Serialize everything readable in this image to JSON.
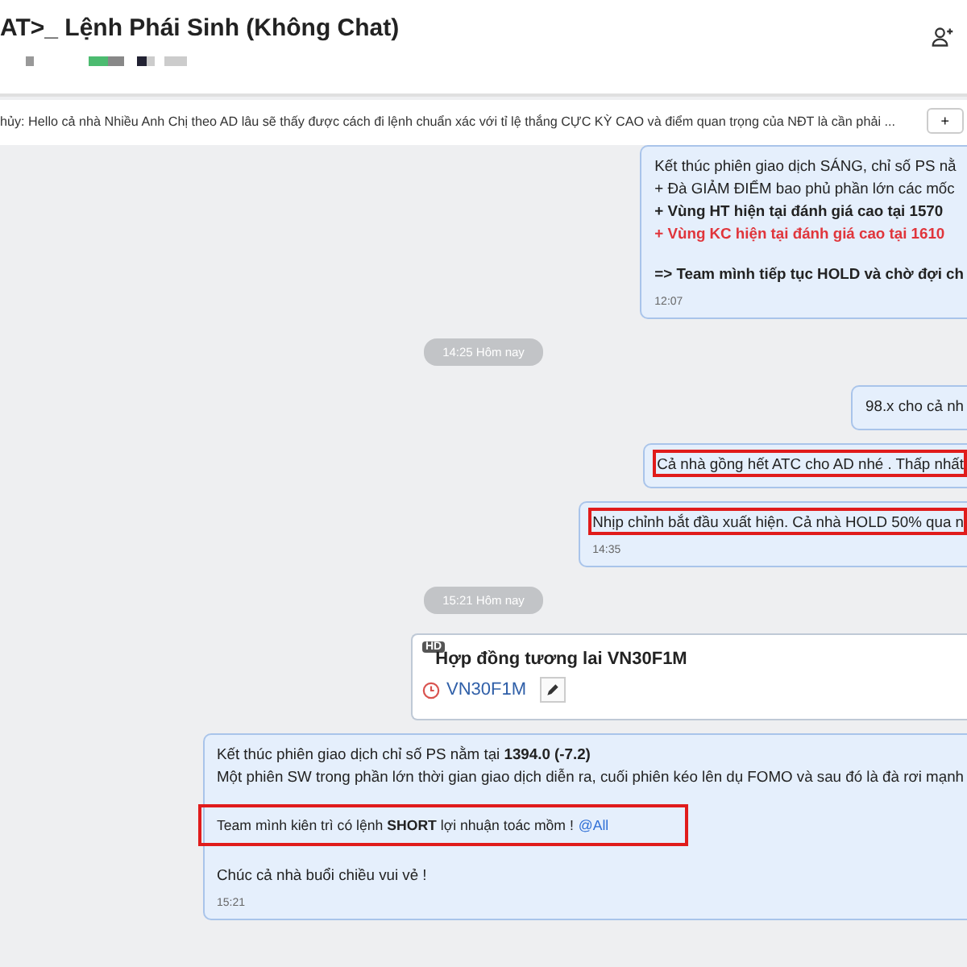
{
  "header": {
    "title": "AT>_ Lệnh Phái Sinh (Không Chat)"
  },
  "pinned": {
    "text": "hủy: Hello cả nhà Nhiều Anh Chị theo AD lâu sẽ thấy được cách đi lệnh chuẩn xác với tỉ lệ thắng CỰC KỲ CAO và điểm quan trọng của NĐT là cần phải ...",
    "button": "+"
  },
  "messages": [
    {
      "kind": "text",
      "lines": [
        {
          "kind": "normal",
          "text": "Kết thúc phiên giao dịch SÁNG, chỉ số PS nằ"
        },
        {
          "kind": "normal",
          "text": "+ Đà GIẢM ĐIỂM bao phủ phần lớn các mốc"
        },
        {
          "kind": "bold",
          "text": "+ Vùng HT hiện tại đánh giá cao tại 1570"
        },
        {
          "kind": "alert",
          "text": "+ Vùng KC hiện tại đánh giá cao tại 1610"
        },
        {
          "kind": "gap"
        },
        {
          "kind": "bold",
          "text": "=> Team mình tiếp tục HOLD và chờ đợi ch"
        }
      ],
      "time": "12:07",
      "highlighted": false
    },
    {
      "kind": "divider",
      "text": "14:25 Hôm nay"
    },
    {
      "kind": "text",
      "lines": [
        {
          "kind": "normal",
          "text": "98.x cho cả nh"
        }
      ],
      "highlighted": false
    },
    {
      "kind": "text",
      "lines": [
        {
          "kind": "normal",
          "text": "Cả nhà gồng hết ATC cho AD nhé . Thấp nhất"
        }
      ],
      "highlighted": true
    },
    {
      "kind": "text",
      "lines": [
        {
          "kind": "normal",
          "text": "Nhịp chỉnh bắt đầu xuất hiện. Cả nhà HOLD 50% qua n"
        }
      ],
      "time": "14:35",
      "highlighted": true
    },
    {
      "kind": "divider",
      "text": "15:21 Hôm nay"
    },
    {
      "kind": "card",
      "badge": "HD",
      "title": "Hợp đồng tương lai VN30F1M",
      "symbol": "VN30F1M"
    },
    {
      "kind": "text",
      "lines": [
        {
          "kind": "normal",
          "text": "Kết thúc phiên giao dịch chỉ số PS nằm tại **1394.0 (-7.2)**"
        },
        {
          "kind": "normal",
          "text": "Một phiên SW trong phần lớn thời gian giao dịch diễn ra, cuối phiên kéo lên dụ FOMO và sau đó là đà rơi mạnh"
        },
        {
          "kind": "gap"
        },
        {
          "kind": "mention",
          "text": "Team mình kiên trì có lệnh **SHORT** lợi nhuận toác mồm !",
          "mention": "@All",
          "highlighted": true
        },
        {
          "kind": "gap"
        },
        {
          "kind": "normal",
          "text": "Chúc cả nhà buổi chiều vui vẻ !"
        }
      ],
      "time": "15:21",
      "highlighted": false
    }
  ]
}
